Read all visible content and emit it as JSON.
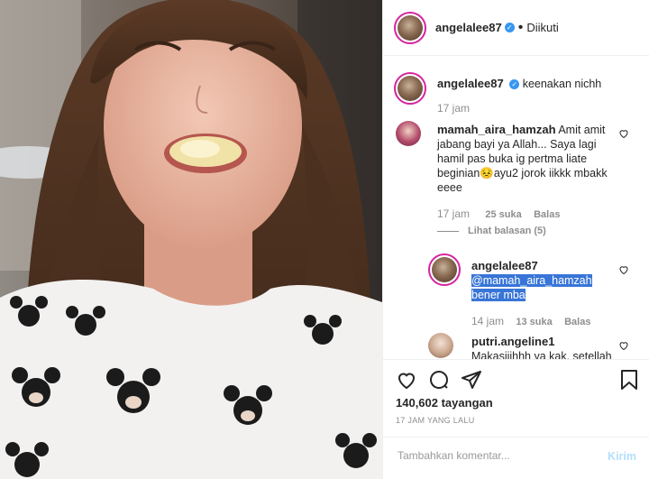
{
  "post": {
    "username": "angelalee87",
    "follow_status": "Diikuti",
    "separator": "•"
  },
  "caption": {
    "username": "angelalee87",
    "text": "keenakan nichh",
    "time": "17 jam"
  },
  "comments": [
    {
      "username": "mamah_aira_hamzah",
      "text": "Amit amit jabang bayi ya Allah... Saya lagi hamil pas buka ig pertma liate beginian",
      "emoji": "😣",
      "text_after": "ayu2 jorok iikkk mbakk eeee",
      "time": "17 jam",
      "likes": "25 suka",
      "reply_label": "Balas",
      "view_replies": "Lihat balasan (5)"
    },
    {
      "username": "angelalee87",
      "mention": "@mamah_aira_hamzah",
      "text": "bener mba",
      "time": "14 jam",
      "likes": "13 suka",
      "reply_label": "Balas"
    },
    {
      "username": "putri.angeline1",
      "text": "Makasiiihhh ya kak, setellah"
    }
  ],
  "stats": {
    "views": "140,602 tayangan",
    "posted": "17 JAM YANG LALU"
  },
  "add_comment": {
    "placeholder": "Tambahkan komentar...",
    "submit": "Kirim"
  },
  "icons": [
    "verified-icon",
    "like-icon",
    "comment-icon",
    "share-icon",
    "save-icon",
    "heart-small-icon"
  ],
  "colors": {
    "link": "#3897f0",
    "muted": "#8e8e8e",
    "text": "#262626",
    "post_disabled": "#b2dffc"
  }
}
